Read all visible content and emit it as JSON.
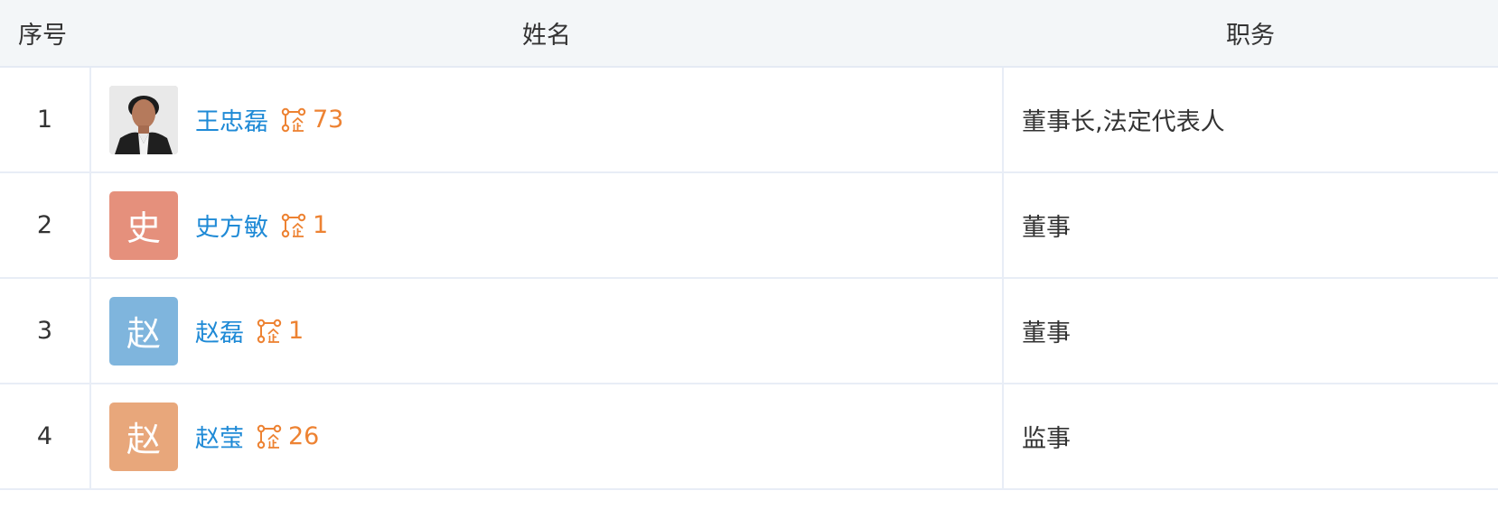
{
  "table": {
    "headers": {
      "index": "序号",
      "name": "姓名",
      "position": "职务"
    },
    "rows": [
      {
        "index": "1",
        "avatar_text": "",
        "avatar_kind": "photo",
        "avatar_color": "#e6e6e6",
        "name": "王忠磊",
        "relation_count": "73",
        "position": "董事长,法定代表人"
      },
      {
        "index": "2",
        "avatar_text": "史",
        "avatar_kind": "letter",
        "avatar_color": "#e5907c",
        "name": "史方敏",
        "relation_count": "1",
        "position": "董事"
      },
      {
        "index": "3",
        "avatar_text": "赵",
        "avatar_kind": "letter",
        "avatar_color": "#7fb5dd",
        "name": "赵磊",
        "relation_count": "1",
        "position": "董事"
      },
      {
        "index": "4",
        "avatar_text": "赵",
        "avatar_kind": "letter",
        "avatar_color": "#e8a77b",
        "name": "赵莹",
        "relation_count": "26",
        "position": "监事"
      }
    ]
  },
  "colors": {
    "header_bg": "#f3f6f8",
    "link": "#1f8ad6",
    "relation": "#ed8232",
    "border": "#e8edf6"
  },
  "icons": {
    "relation": "enterprise-relation-icon"
  }
}
